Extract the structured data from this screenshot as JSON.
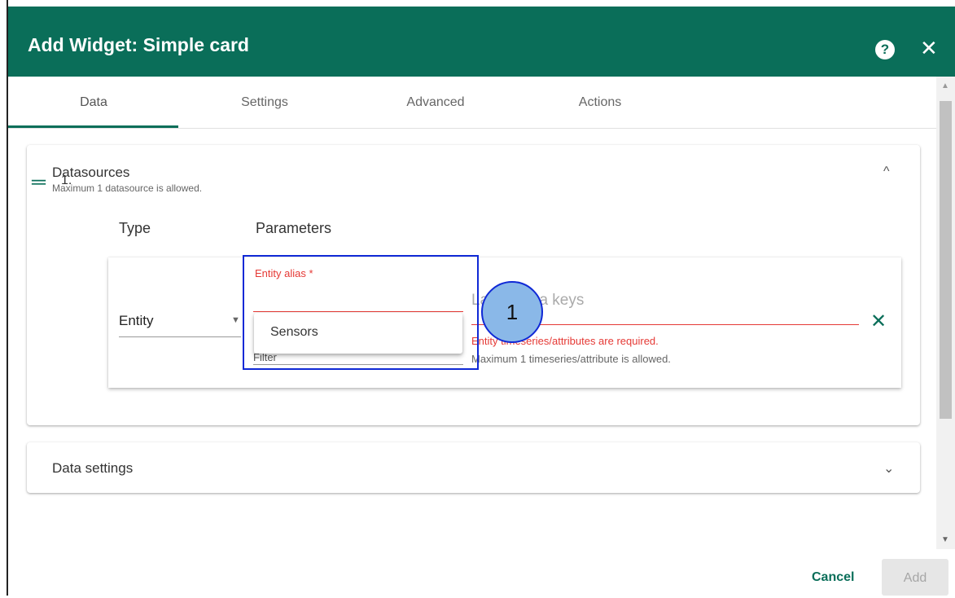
{
  "dialog": {
    "title": "Add Widget: Simple card",
    "help_icon": "?",
    "close_icon": "✕"
  },
  "tabs": [
    {
      "label": "Data"
    },
    {
      "label": "Settings"
    },
    {
      "label": "Advanced"
    },
    {
      "label": "Actions"
    }
  ],
  "datasources": {
    "title": "Datasources",
    "subtitle": "Maximum 1 datasource is allowed.",
    "collapse_icon": "^",
    "columns": {
      "type": "Type",
      "parameters": "Parameters"
    },
    "row": {
      "index": "1.",
      "drag_icon": "═",
      "type_value": "Entity",
      "alias_label": "Entity alias *",
      "filter_partial": "Filter",
      "keys_placeholder": "Latest data keys",
      "keys_error": "Entity timeseries/attributes are required.",
      "keys_hint": "Maximum 1 timeseries/attribute is allowed.",
      "remove_icon": "✕"
    },
    "dropdown_options": [
      "Sensors"
    ]
  },
  "data_settings": {
    "title": "Data settings",
    "expand_icon": "⌄"
  },
  "annotation": {
    "label": "1"
  },
  "footer": {
    "cancel": "Cancel",
    "add": "Add"
  },
  "colors": {
    "primary": "#0a6e59",
    "error": "#e53935",
    "callout": "#1029d6"
  }
}
